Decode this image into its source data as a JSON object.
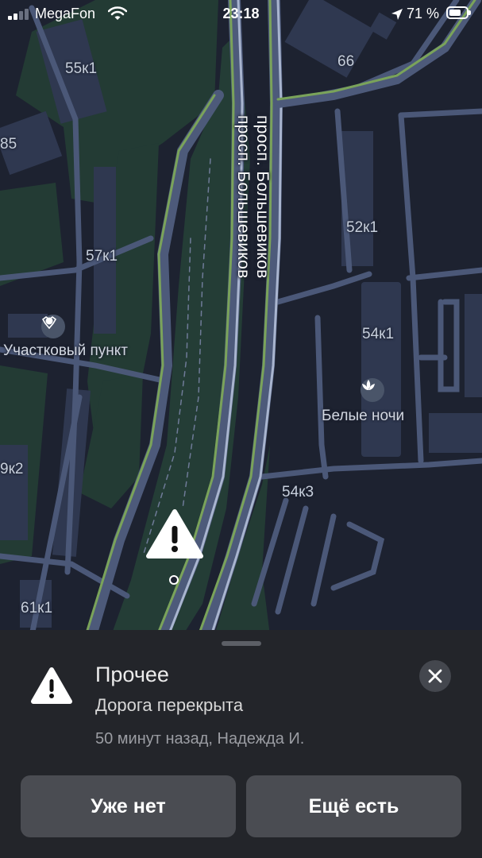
{
  "status_bar": {
    "carrier": "MegaFon",
    "time": "23:18",
    "battery_percent": "71 %",
    "battery_level": 0.71,
    "icons": [
      "signal-icon",
      "wifi-icon",
      "location-arrow-icon",
      "battery-icon"
    ]
  },
  "map": {
    "street_name": "просп. Большевиков",
    "building_labels": [
      "55к1",
      "66",
      "85",
      "52к1",
      "57к1",
      "54к1",
      "9к2",
      "54к3",
      "61к1"
    ],
    "pois": [
      {
        "name": "Участковый пункт",
        "icon": "police-icon"
      },
      {
        "name": "Белые ночи",
        "icon": "lotus-icon"
      }
    ],
    "incident_icon": "warning-icon"
  },
  "incident_card": {
    "category": "Прочее",
    "description": "Дорога перекрыта",
    "meta": "50 минут назад, Надежда И.",
    "icon": "warning-icon",
    "close_icon": "close-icon",
    "buttons": {
      "gone_label": "Уже нет",
      "still_label": "Ещё есть"
    }
  },
  "colors": {
    "map_background": "#1d2230",
    "park": "#233b34",
    "road": "#4d5a7a",
    "traffic_green": "#7aa35a",
    "sheet_background": "#23252a",
    "button_background": "#4a4c52"
  }
}
